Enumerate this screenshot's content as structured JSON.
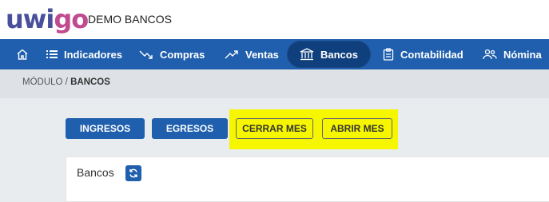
{
  "header": {
    "logo_part1": "uwi",
    "logo_part2": "go",
    "company": "DEMO BANCOS"
  },
  "nav": {
    "home_icon": "home-icon",
    "items": [
      {
        "label": "Indicadores",
        "icon": "list-icon"
      },
      {
        "label": "Compras",
        "icon": "trend-down-icon"
      },
      {
        "label": "Ventas",
        "icon": "trend-up-icon"
      },
      {
        "label": "Bancos",
        "icon": "bank-icon",
        "active": true
      },
      {
        "label": "Contabilidad",
        "icon": "clipboard-icon"
      },
      {
        "label": "Nómina",
        "icon": "users-icon"
      }
    ]
  },
  "breadcrumb": {
    "module": "MÓDULO /",
    "current": "BANCOS"
  },
  "actions": {
    "ingresos": "INGRESOS",
    "egresos": "EGRESOS",
    "cerrar_mes": "CERRAR MES",
    "abrir_mes": "ABRIR MES"
  },
  "card": {
    "title": "Bancos",
    "refresh_icon": "refresh-icon"
  },
  "colors": {
    "primary": "#1f5fad",
    "active_nav": "#0f3f7d",
    "highlight": "#f6f600"
  }
}
